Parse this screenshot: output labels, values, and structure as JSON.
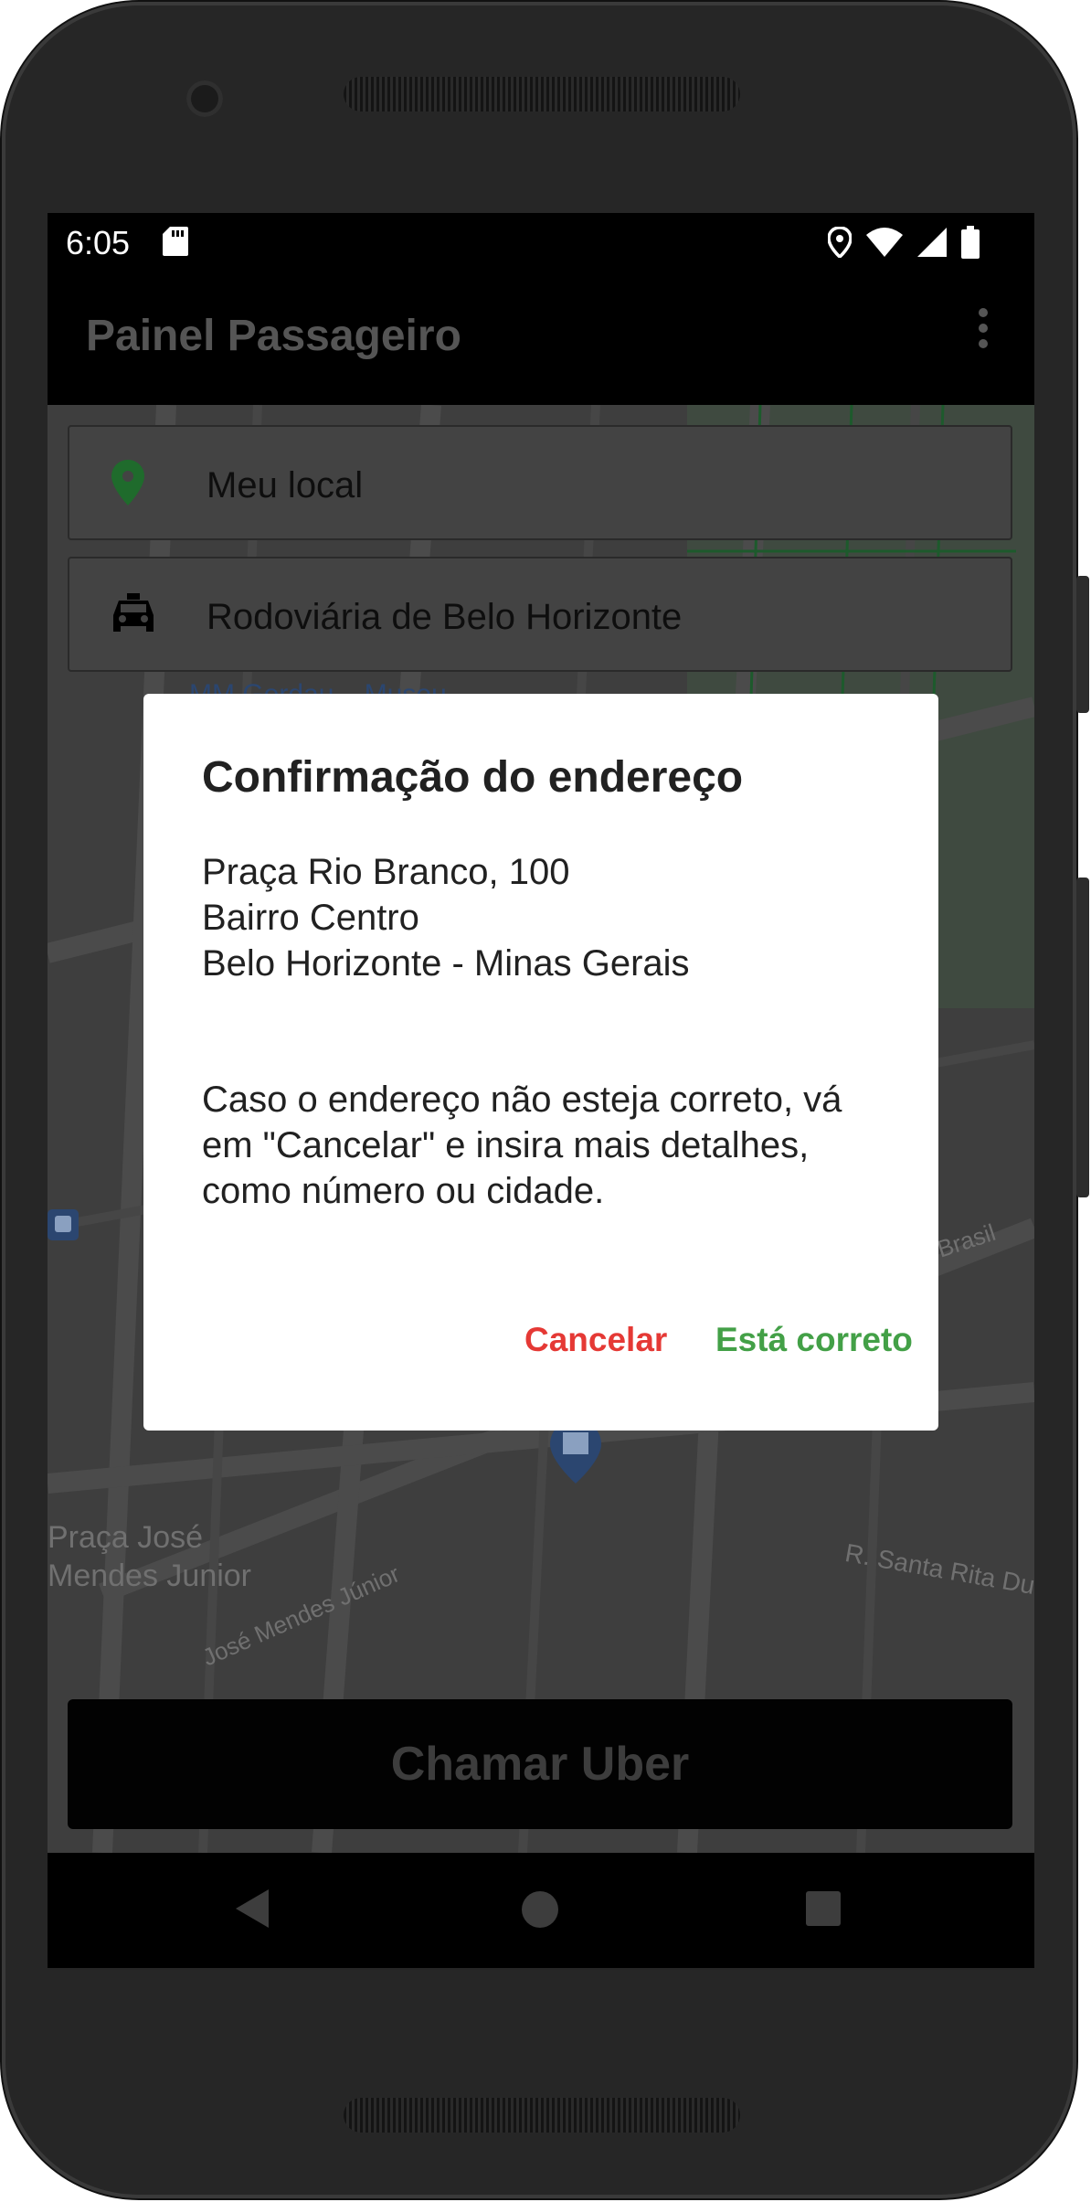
{
  "status_bar": {
    "time": "6:05"
  },
  "app_bar": {
    "title": "Painel Passageiro"
  },
  "map": {
    "labels": {
      "praca_line1": "Praça José",
      "praca_line2": "Mendes Junior",
      "street_mendes": "José Mendes Júnior",
      "street_santa_rita": "R. Santa Rita Durão",
      "street_brasil": "Brasil",
      "museum_label": "MM Gerdau – Museu"
    }
  },
  "search": {
    "origin_value": "Meu local",
    "destination_value": "Rodoviária de Belo Horizonte"
  },
  "dialog": {
    "title": "Confirmação do endereço",
    "address_line1": "Praça Rio Branco, 100",
    "address_line2": "Bairro Centro",
    "address_line3": "Belo Horizonte - Minas Gerais",
    "message": "Caso o endereço não esteja correto, vá em \"Cancelar\" e insira mais detalhes, como número ou cidade.",
    "cancel_label": "Cancelar",
    "confirm_label": "Está correto"
  },
  "call_button": {
    "label": "Chamar Uber"
  },
  "colors": {
    "cancel": "#e53935",
    "confirm": "#43a047",
    "pin": "#43a047"
  },
  "icons": [
    "sd-card-icon",
    "location-icon",
    "wifi-icon",
    "signal-icon",
    "battery-icon",
    "overflow-menu-icon",
    "location-pin-icon",
    "taxi-icon",
    "bus-stop-icon",
    "museum-icon",
    "back-icon",
    "home-icon",
    "recents-icon"
  ]
}
